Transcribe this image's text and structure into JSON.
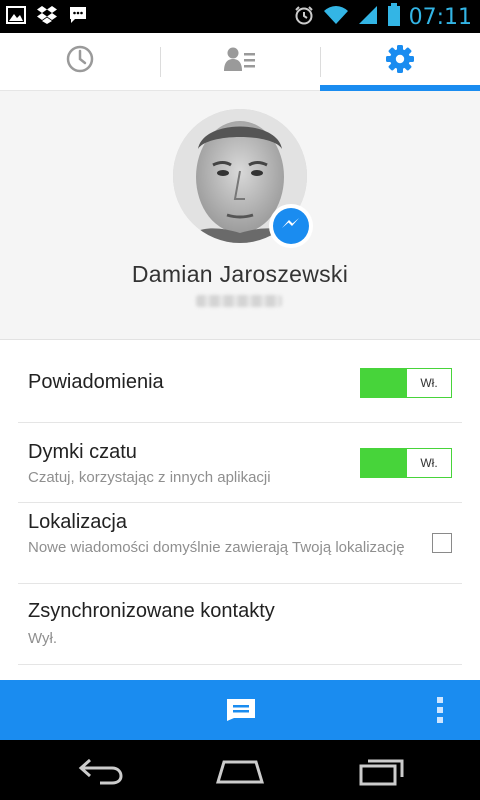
{
  "status_bar": {
    "time": "07:11",
    "left_icons": [
      "gallery-icon",
      "dropbox-icon",
      "chat-bubble-icon"
    ],
    "right_icons": [
      "alarm-icon",
      "wifi-icon",
      "signal-icon",
      "battery-icon"
    ]
  },
  "tabs": [
    {
      "icon": "clock-icon",
      "active": false
    },
    {
      "icon": "contacts-icon",
      "active": false
    },
    {
      "icon": "gear-icon",
      "active": true
    }
  ],
  "profile": {
    "name": "Damian Jaroszewski"
  },
  "settings": {
    "notifications": {
      "title": "Powiadomienia",
      "toggle_label": "Wł.",
      "on": true
    },
    "chat_heads": {
      "title": "Dymki czatu",
      "subtitle": "Czatuj, korzystając z innych aplikacji",
      "toggle_label": "Wł.",
      "on": true
    },
    "location": {
      "title": "Lokalizacja",
      "subtitle": "Nowe wiadomości domyślnie zawierają Twoją lokalizację",
      "checked": false
    },
    "synced_contacts": {
      "title": "Zsynchronizowane kontakty",
      "subtitle": "Wył."
    }
  },
  "colors": {
    "accent": "#1a8cf0",
    "toggle_on": "#47d43a",
    "status_time": "#33b5e5"
  }
}
